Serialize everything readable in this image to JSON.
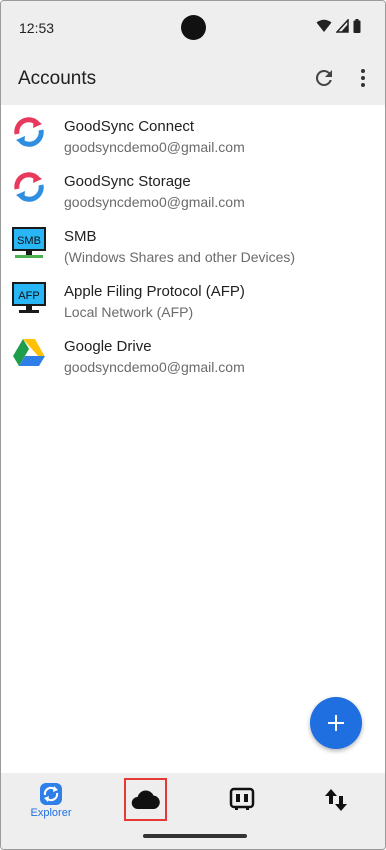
{
  "status": {
    "time": "12:53"
  },
  "app_bar": {
    "title": "Accounts"
  },
  "accounts": [
    {
      "title": "GoodSync Connect",
      "subtitle": "goodsyncdemo0@gmail.com",
      "icon": "goodsync-sync-icon"
    },
    {
      "title": "GoodSync Storage",
      "subtitle": "goodsyncdemo0@gmail.com",
      "icon": "goodsync-sync-icon"
    },
    {
      "title": "SMB",
      "subtitle": "(Windows Shares and other Devices)",
      "icon": "smb-monitor-icon",
      "badge": "SMB"
    },
    {
      "title": "Apple Filing Protocol (AFP)",
      "subtitle": "Local Network (AFP)",
      "icon": "afp-monitor-icon",
      "badge": "AFP"
    },
    {
      "title": "Google Drive",
      "subtitle": "goodsyncdemo0@gmail.com",
      "icon": "google-drive-icon"
    }
  ],
  "bottom_nav": {
    "explorer_label": "Explorer"
  },
  "colors": {
    "accent": "#1f6fe0",
    "highlight_border": "#e53935",
    "bar_background": "#eeeeee"
  }
}
